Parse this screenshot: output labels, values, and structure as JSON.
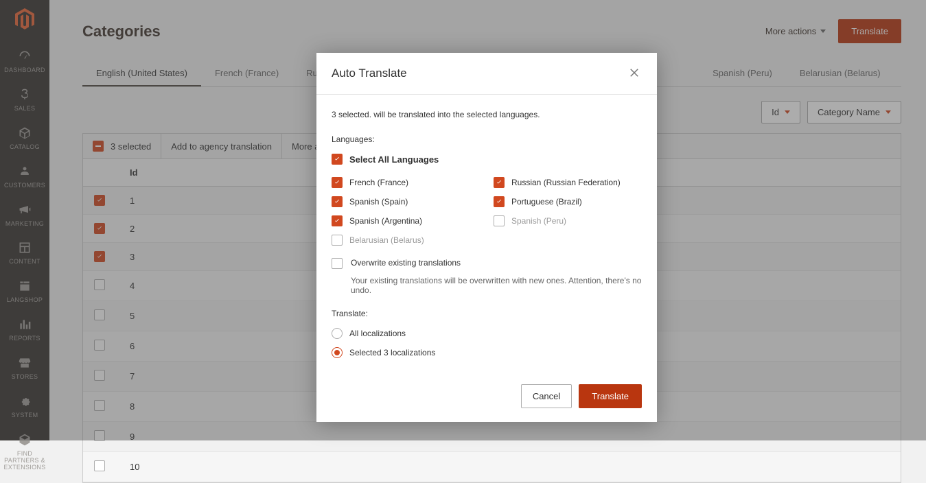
{
  "sidebar": {
    "items": [
      {
        "label": "DASHBOARD"
      },
      {
        "label": "SALES"
      },
      {
        "label": "CATALOG"
      },
      {
        "label": "CUSTOMERS"
      },
      {
        "label": "MARKETING"
      },
      {
        "label": "CONTENT"
      },
      {
        "label": "LANGSHOP"
      },
      {
        "label": "REPORTS"
      },
      {
        "label": "STORES"
      },
      {
        "label": "SYSTEM"
      },
      {
        "label": "FIND PARTNERS & EXTENSIONS"
      }
    ]
  },
  "page": {
    "title": "Categories",
    "more_actions": "More actions",
    "translate_btn": "Translate"
  },
  "tabs": [
    "English (United States)",
    "French (France)",
    "Russian (Russian Federation)",
    "Spanish (Peru)",
    "Belarusian (Belarus)"
  ],
  "filters": {
    "id": "Id",
    "cat": "Category Name"
  },
  "toolbar": {
    "selected": "3 selected",
    "agency": "Add to agency translation",
    "more": "More actions"
  },
  "table": {
    "header_id": "Id",
    "rows": [
      {
        "id": "1",
        "checked": true
      },
      {
        "id": "2",
        "checked": true
      },
      {
        "id": "3",
        "checked": true
      },
      {
        "id": "4",
        "checked": false
      },
      {
        "id": "5",
        "checked": false
      },
      {
        "id": "6",
        "checked": false
      },
      {
        "id": "7",
        "checked": false
      },
      {
        "id": "8",
        "checked": false
      },
      {
        "id": "9",
        "checked": false
      },
      {
        "id": "10",
        "checked": false
      }
    ]
  },
  "modal": {
    "title": "Auto Translate",
    "info": "3 selected. will be translated into the selected languages.",
    "languages_label": "Languages:",
    "select_all": "Select All Languages",
    "langs_left": [
      {
        "name": "French (France)",
        "checked": true
      },
      {
        "name": "Spanish (Spain)",
        "checked": true
      },
      {
        "name": "Spanish (Argentina)",
        "checked": true
      },
      {
        "name": "Belarusian (Belarus)",
        "checked": false
      }
    ],
    "langs_right": [
      {
        "name": "Russian (Russian Federation)",
        "checked": true
      },
      {
        "name": "Portuguese (Brazil)",
        "checked": true
      },
      {
        "name": "Spanish (Peru)",
        "checked": false
      }
    ],
    "overwrite_label": "Overwrite existing translations",
    "overwrite_desc": "Your existing translations will be overwritten with new ones. Attention, there's no undo.",
    "translate_label": "Translate:",
    "opt_all": "All localizations",
    "opt_sel": "Selected 3 localizations",
    "cancel": "Cancel",
    "confirm": "Translate"
  }
}
